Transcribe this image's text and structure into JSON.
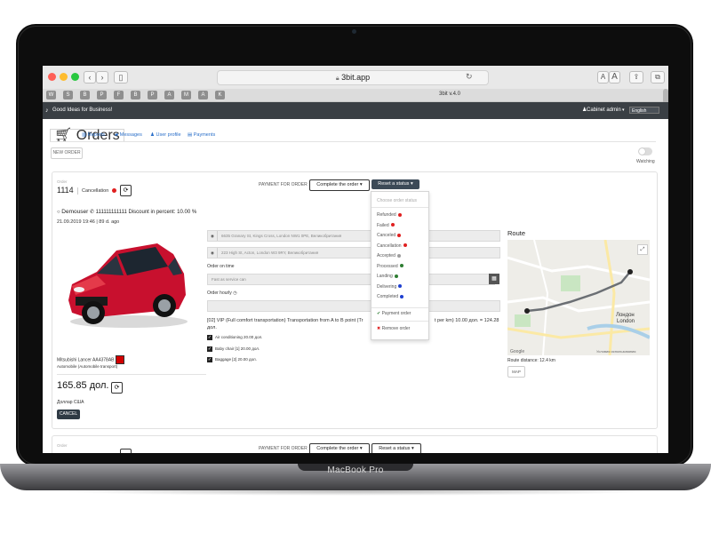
{
  "device": {
    "label": "MacBook Pro"
  },
  "browser": {
    "url": "3bit.app",
    "reader_small": "A",
    "reader_large": "A",
    "tab_title": "3bit v.4.0",
    "bookmarks": [
      "W",
      "S",
      "B",
      "P",
      "F",
      "B",
      "P",
      "A",
      "M",
      "A",
      "K"
    ]
  },
  "app": {
    "tagline": "Good Ideas for Business!",
    "cabinet_label": "Cabinet admin",
    "language": "English"
  },
  "tabs": [
    {
      "label": "Orders"
    },
    {
      "label": "Reports"
    },
    {
      "label": "Messages"
    },
    {
      "label": "User profile"
    },
    {
      "label": "Payments"
    }
  ],
  "toolbar": {
    "new_order": "NEW ORDER",
    "watching": "Watching"
  },
  "order": {
    "caption": "Order",
    "number": "1114",
    "status": "Cancellation",
    "status_color": "#e02020",
    "payment_for_order": "PAYMENT FOR ORDER",
    "complete_button": "Complete the order",
    "reset_button": "Reset a status",
    "customer": "Demouser",
    "phone": "111111111111",
    "discount": "Discount in percent: 10.00 %",
    "datetime": "21.09.2019 19:46 | 89 d. ago",
    "from": "6635 Granary St, Kings Cross, London NW1 0PE, Великобритания",
    "to": "223 High St, Acton, London W3 9RY, Великобритания",
    "order_on_time_label": "Order on time",
    "order_on_time_value": "Fast as service can",
    "order_hourly_label": "Order hourly",
    "tariff_text_1": "[02] VIP (Full comfort transportation) Transportation from A to B point (Tr",
    "tariff_text_2": "t per km) 10.00 дол. = 124.28",
    "tariff_text_3": "дол.",
    "options": [
      "Air conditioning 20.00 дол.",
      "Baby chair [1] 20.00 дол.",
      "Baggage [2] 20.00 дол."
    ],
    "car_name": "Mitsubishi Lancer AA4378AB",
    "car_type": "Automobile (Automobile transport)",
    "price": "165.85 дол.",
    "currency": "Доллар США",
    "cancel_button": "CANCEL",
    "route_title": "Route",
    "map_label": "Лондон\nLondon",
    "map_credit": "Условия использования",
    "route_distance": "Route distance: 12.4 km",
    "map_button": "MAP"
  },
  "status_menu": {
    "header": "Choose order status",
    "items": [
      {
        "label": "Refunded",
        "color": "#e02020"
      },
      {
        "label": "Failed",
        "color": "#e02020"
      },
      {
        "label": "Canceled",
        "color": "#e02020"
      },
      {
        "label": "Cancellation",
        "color": "#e02020"
      },
      {
        "label": "Accepted",
        "color": "#9e9e9e"
      },
      {
        "label": "Processed",
        "color": "#2e7d32"
      },
      {
        "label": "Landing",
        "color": "#2e7d32"
      },
      {
        "label": "Delivering",
        "color": "#1e3fd0"
      },
      {
        "label": "Completed",
        "color": "#1e3fd0"
      }
    ],
    "payment_order": "Payment order",
    "remove_order": "Remove order"
  },
  "order2": {
    "caption": "Order",
    "payment_for_order": "PAYMENT FOR ORDER",
    "complete_button": "Complete the order",
    "reset_button": "Reset a status"
  }
}
